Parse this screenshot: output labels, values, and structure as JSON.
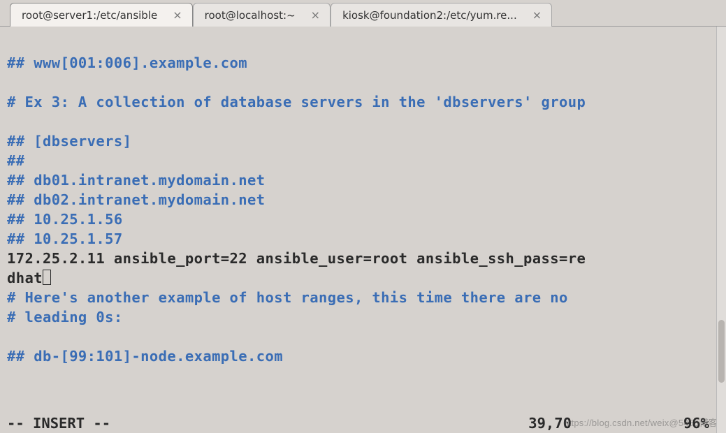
{
  "tabs": [
    {
      "label": "root@server1:/etc/ansible",
      "active": true
    },
    {
      "label": "root@localhost:~",
      "active": false
    },
    {
      "label": "kiosk@foundation2:/etc/yum.re...",
      "active": false
    }
  ],
  "lines": {
    "l1": "## www[001:006].example.com",
    "l2": "",
    "l3": "# Ex 3: A collection of database servers in the 'dbservers' group",
    "l4": "",
    "l5": "## [dbservers]",
    "l6": "## ",
    "l7": "## db01.intranet.mydomain.net",
    "l8": "## db02.intranet.mydomain.net",
    "l9": "## 10.25.1.56",
    "l10": "## 10.25.1.57",
    "l11a": "172.25.2.11 ansible_port=22 ansible_user=root ansible_ssh_pass=re",
    "l11b": "dhat",
    "l12": "# Here's another example of host ranges, this time there are no ",
    "l13": "# leading 0s:",
    "l14": "",
    "l15": "## db-[99:101]-node.example.com"
  },
  "status": {
    "mode": "-- INSERT --",
    "position": "39,70",
    "percent": "96%"
  },
  "watermark": "https://blog.csdn.net/weix@5455博客"
}
